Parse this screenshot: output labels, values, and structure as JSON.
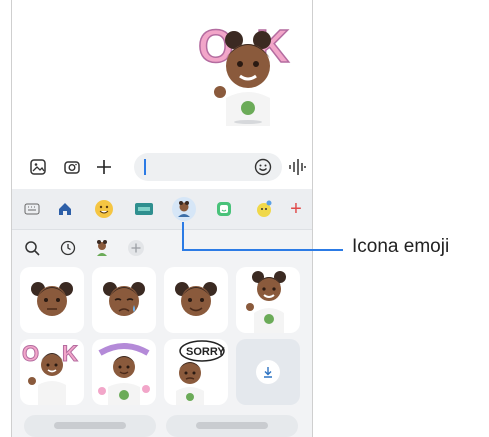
{
  "callout": {
    "label": "Icona emoji"
  },
  "composer": {
    "gallery_icon": "image-icon",
    "camera_icon": "camera-icon",
    "add_icon": "plus-icon",
    "emoji_icon": "smile-icon",
    "voice_icon": "voice-wave-icon"
  },
  "keyboard": {
    "tabs": [
      "keyboard-icon",
      "home-icon",
      "emoji-face-icon",
      "gif-icon",
      "ar-emoji-icon",
      "sticker-icon",
      "bitmoji-icon",
      "add-icon"
    ],
    "selected_tab": "ar-emoji-icon",
    "subtabs": [
      "search-icon",
      "recent-icon",
      "avatar-icon",
      "add-icon"
    ]
  },
  "stickers": [
    "avatar-neutral",
    "avatar-crying",
    "avatar-smile",
    "avatar-ok",
    "avatar-ok-sign",
    "avatar-thanks",
    "avatar-sorry",
    "download"
  ],
  "colors": {
    "accent": "#2c7be5",
    "selected_tab_bg": "#d6e6f7",
    "red_plus": "#e04a4a"
  }
}
